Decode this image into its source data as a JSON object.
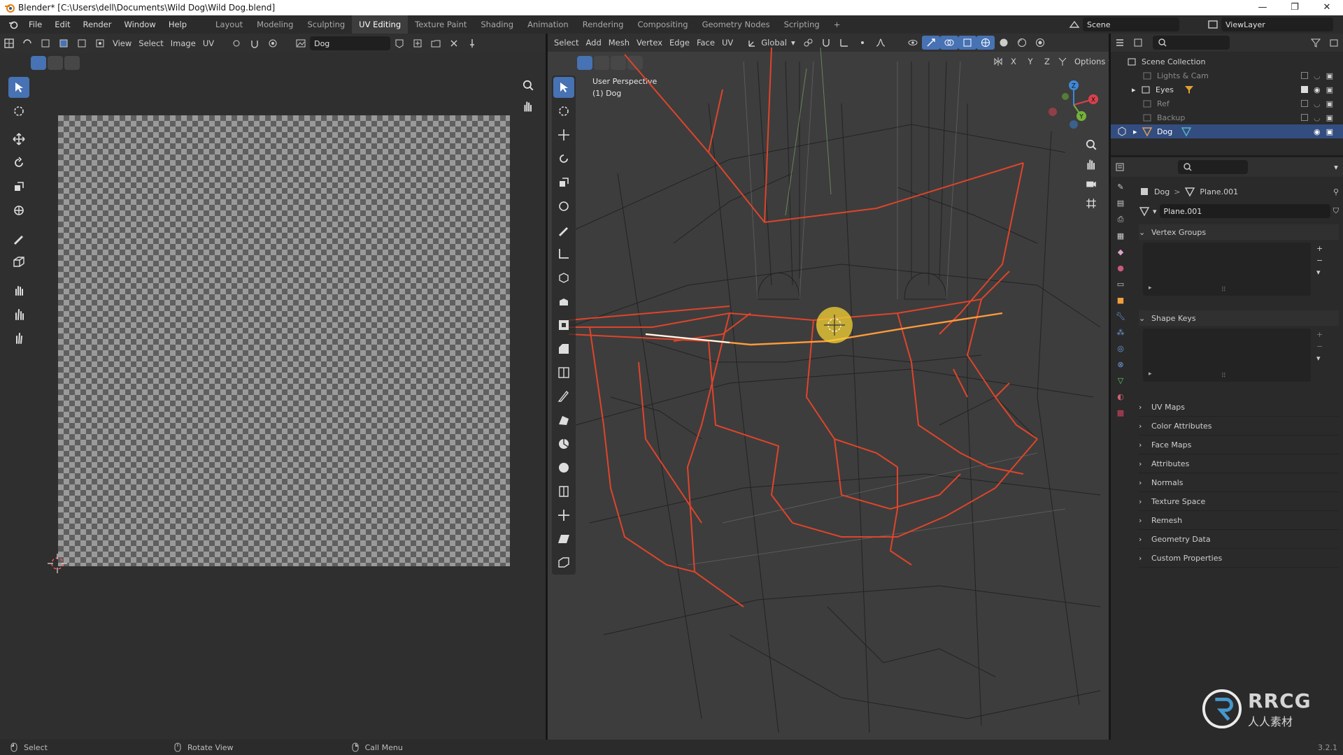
{
  "window": {
    "title": "Blender* [C:\\Users\\dell\\Documents\\Wild Dog\\Wild Dog.blend]",
    "controls": [
      "—",
      "❐",
      "✕"
    ]
  },
  "topbar": {
    "menus": [
      "File",
      "Edit",
      "Render",
      "Window",
      "Help"
    ],
    "workspaces": [
      "Layout",
      "Modeling",
      "Sculpting",
      "UV Editing",
      "Texture Paint",
      "Shading",
      "Animation",
      "Rendering",
      "Compositing",
      "Geometry Nodes",
      "Scripting"
    ],
    "active_workspace": "UV Editing",
    "add_tab": "+",
    "scene": "Scene",
    "view_layer": "ViewLayer"
  },
  "uv_editor": {
    "header_menus": [
      "View",
      "Select",
      "Image",
      "UV"
    ],
    "image_name": "Dog"
  },
  "viewport": {
    "header_menus": [
      "Select",
      "Add",
      "Mesh",
      "Vertex",
      "Edge",
      "Face",
      "UV"
    ],
    "transform_orientation": "Global",
    "options_label": "Options",
    "axis_toggles": [
      "X",
      "Y",
      "Z"
    ],
    "overlay_line1": "User Perspective",
    "overlay_line2": "(1) Dog",
    "gizmo": {
      "x": "X",
      "y": "Y",
      "z": "Z"
    }
  },
  "outliner": {
    "root": "Scene Collection",
    "items": [
      {
        "label": "Lights & Cam",
        "dim": true
      },
      {
        "label": "Eyes",
        "dim": false
      },
      {
        "label": "Ref",
        "dim": true
      },
      {
        "label": "Backup",
        "dim": true
      },
      {
        "label": "Dog",
        "dim": false,
        "selected": true
      }
    ]
  },
  "properties": {
    "breadcrumb_object": "Dog",
    "breadcrumb_sep": ">",
    "breadcrumb_mesh": "Plane.001",
    "mesh_name": "Plane.001",
    "panels_open": [
      "Vertex Groups",
      "Shape Keys"
    ],
    "panels_closed": [
      "UV Maps",
      "Color Attributes",
      "Face Maps",
      "Attributes",
      "Normals",
      "Texture Space",
      "Remesh",
      "Geometry Data",
      "Custom Properties"
    ],
    "list_add": "+",
    "list_remove": "−"
  },
  "statusbar": {
    "select": "Select",
    "rotate": "Rotate View",
    "menu": "Call Menu",
    "version": "3.2.1"
  },
  "watermark": {
    "brand": "RRCG",
    "sub": "人人素材"
  },
  "colors": {
    "accent": "#4772b3",
    "selected_edge": "#e0442a",
    "mesh_wire": "#1a1a1a",
    "viewport_bg": "#3d3d3d",
    "highlight_edge": "#ff9b3a"
  }
}
